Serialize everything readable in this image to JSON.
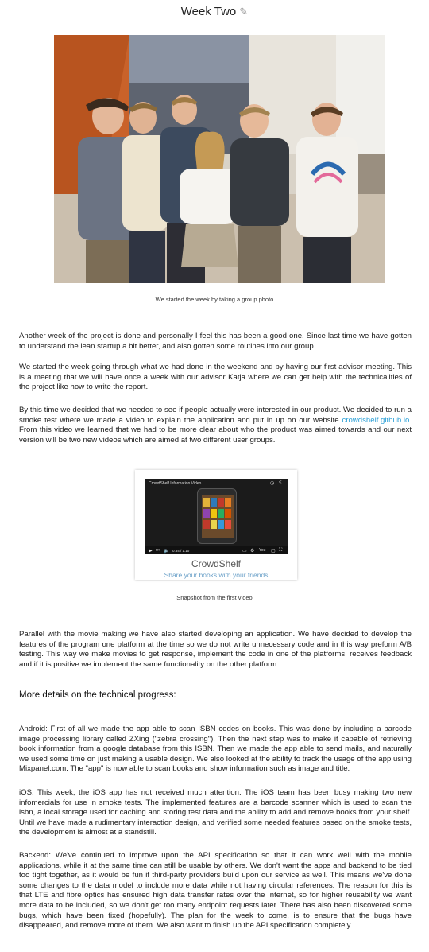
{
  "title": "Week Two",
  "photo_caption": "We started the week by taking a group photo",
  "paragraphs": {
    "p1": "Another week of the project is done and personally I feel this has been a good one. Since last time we have gotten to understand the lean startup a bit better, and also gotten some routines into our group.",
    "p2": "We started the week going through what we had done in the weekend and by having our first advisor meeting. This is a meeting that we will have once a week with our advisor Katja where we can get help with the technicalities of the project like how to write the report.",
    "p3_before": "By this time we decided that we needed to see if people actually were interested in our product. We decided to run a smoke test where we made a video to explain the application and put in up on our website ",
    "p3_link": "crowdshelf.github.io",
    "p3_after": ". From this video we learned that we had to be more clear about who the product was aimed towards and our next version will be two new videos which are aimed at two different user groups.",
    "p4": "Parallel with the movie making we have also started developing an application. We have decided to develop the features of the program one platform at the time so we do not write unnecessary code and in this way preform A/B testing. This way we make movies to get response, implement the code in one of the platforms, receives feedback and if it is positive we implement the same functionality on the other platform.",
    "p5": "Android: First of all we made the app able to scan ISBN codes on books. This was done by including a barcode image processing library called ZXing (\"zebra crossing\"). Then the next step was to make it capable of retrieving book information from a google database from this ISBN. Then we made the app able to send mails, and naturally we used some time on just making a usable design. We also looked at the ability to track the usage of the app using Mixpanel.com. The \"app\" is now able to scan books and show information such as image and title.",
    "p6": "iOS: This week, the iOS app has not received much attention. The iOS team has been busy making two new infomercials for use in smoke tests. The implemented features are a barcode scanner which is used to scan the isbn, a local storage used for caching and storing test data and the ability to add and remove books from your shelf. Until we have made a rudimentary interaction design, and verified some needed features based on the smoke tests, the development is almost at a standstill.",
    "p7": "Backend: We've continued to improve upon the API specification so that it can work well with the mobile applications, while it at the same time can still be usable by others. We don't want the apps and backend to be tied too tight together, as it would be fun if third-party providers build upon our service as well.  This means we've done some changes to the data model to include more data while not having circular references. The reason for this is that LTE and fibre optics has ensured high data transfer rates over the Internet, so for higher reusability we want more data to be included, so we don't get too many endpoint requests later. There has also been discovered some bugs, which have been fixed (hopefully). The plan for the week to come, is to ensure that the bugs have disappeared, and remove more of them. We also want to finish up the API specification completely."
  },
  "video": {
    "title": "CrowdShelf Information Video",
    "time": "0:34 / 1:10",
    "brand": "CrowdShelf",
    "tagline": "Share your books with your friends",
    "caption": "Snapshot from the first video",
    "progress": 0.32,
    "progress_color": "#e02020"
  },
  "subheading": "More details on the technical progress:",
  "icons": {
    "title_edit": "pencil-icon"
  },
  "colors": {
    "link": "#2a9fd6",
    "tagline": "#6aa0c8"
  }
}
